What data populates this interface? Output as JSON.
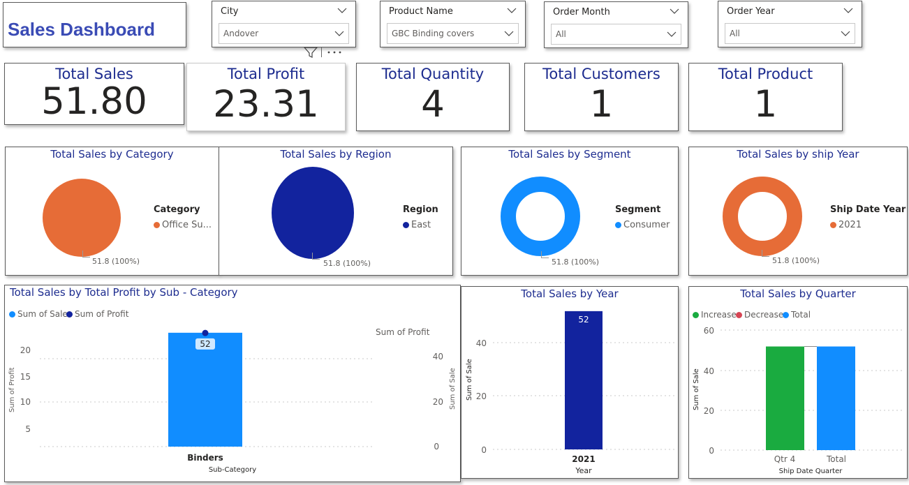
{
  "header": {
    "title": "Sales Dashboard"
  },
  "slicers": [
    {
      "label": "City",
      "value": "Andover"
    },
    {
      "label": "Product Name",
      "value": "GBC Binding covers"
    },
    {
      "label": "Order Month",
      "value": "All"
    },
    {
      "label": "Order Year",
      "value": "All"
    }
  ],
  "visual_header": {
    "filter_icon": "filter-icon",
    "more_icon": "more-options-icon"
  },
  "cards": [
    {
      "title": "Total Sales",
      "value": "51.80"
    },
    {
      "title": "Total Profit",
      "value": "23.31"
    },
    {
      "title": "Total Quantity",
      "value": "4"
    },
    {
      "title": "Total Customers",
      "value": "1"
    },
    {
      "title": "Total Product",
      "value": "1"
    }
  ],
  "pies": [
    {
      "title": "Total Sales by Category",
      "legend_title": "Category",
      "legend_item": "Office Su...",
      "color": "#e66c37",
      "label": "51.8 (100%)",
      "donut": false
    },
    {
      "title": "Total Sales by Region",
      "legend_title": "Region",
      "legend_item": "East",
      "color": "#12239e",
      "label": "51.8 (100%)",
      "donut": false
    },
    {
      "title": "Total Sales by Segment",
      "legend_title": "Segment",
      "legend_item": "Consumer",
      "color": "#118dff",
      "label": "51.8 (100%)",
      "donut": true
    },
    {
      "title": "Total Sales by ship Year",
      "legend_title": "Ship Date Year",
      "legend_item": "2021",
      "color": "#e66c37",
      "label": "51.8 (100%)",
      "donut": true
    }
  ],
  "combo": {
    "title": "Total Sales by Total Profit by Sub - Category",
    "legend": [
      {
        "name": "Sum of Sale",
        "color": "#118dff"
      },
      {
        "name": "Sum of Profit",
        "color": "#12239e"
      }
    ],
    "ylabel_left": "Sum of Profit",
    "ylabel_right": "Sum of Sale",
    "right_axis_title": "Sum of Profit",
    "left_ticks": [
      "20",
      "15",
      "10",
      "5"
    ],
    "right_ticks": [
      "40",
      "20",
      "0"
    ],
    "category": "Binders",
    "bar_label": "52",
    "xlabel": "Sub-Category"
  },
  "year_chart": {
    "title": "Total Sales by Year",
    "ylabel": "Sum of Sale",
    "xlabel": "Year",
    "ticks": [
      "40",
      "20",
      "0"
    ],
    "category": "2021",
    "bar_label": "52"
  },
  "quarter_chart": {
    "title": "Total Sales by Quarter",
    "legend": [
      {
        "name": "Increase",
        "color": "#1aab40"
      },
      {
        "name": "Decrease",
        "color": "#d64554"
      },
      {
        "name": "Total",
        "color": "#118dff"
      }
    ],
    "ylabel": "Sum of Sale",
    "xlabel": "Ship Date Quarter",
    "ticks": [
      "60",
      "40",
      "20",
      "0"
    ],
    "categories": [
      "Qtr 4",
      "Total"
    ]
  },
  "chart_data": [
    {
      "type": "pie",
      "title": "Total Sales by Category",
      "categories": [
        "Office Su..."
      ],
      "values": [
        51.8
      ],
      "legend_title": "Category"
    },
    {
      "type": "pie",
      "title": "Total Sales by Region",
      "categories": [
        "East"
      ],
      "values": [
        51.8
      ],
      "legend_title": "Region"
    },
    {
      "type": "pie",
      "title": "Total Sales by Segment",
      "categories": [
        "Consumer"
      ],
      "values": [
        51.8
      ],
      "legend_title": "Segment"
    },
    {
      "type": "pie",
      "title": "Total Sales by ship Year",
      "categories": [
        "2021"
      ],
      "values": [
        51.8
      ],
      "legend_title": "Ship Date Year"
    },
    {
      "type": "bar",
      "title": "Total Sales by Total Profit by Sub - Category",
      "categories": [
        "Binders"
      ],
      "series": [
        {
          "name": "Sum of Sale",
          "values": [
            51.8
          ]
        },
        {
          "name": "Sum of Profit",
          "values": [
            23.31
          ]
        }
      ],
      "xlabel": "Sub-Category",
      "ylabel": "Sum of Profit",
      "ylim": [
        0,
        25
      ],
      "y2label": "Sum of Sale",
      "y2lim": [
        0,
        55
      ]
    },
    {
      "type": "bar",
      "title": "Total Sales by Year",
      "categories": [
        "2021"
      ],
      "values": [
        51.8
      ],
      "xlabel": "Year",
      "ylabel": "Sum of Sale",
      "ylim": [
        0,
        55
      ]
    },
    {
      "type": "bar",
      "title": "Total Sales by Quarter",
      "categories": [
        "Qtr 4",
        "Total"
      ],
      "series": [
        {
          "name": "Increase",
          "values": [
            51.8,
            null
          ]
        },
        {
          "name": "Total",
          "values": [
            null,
            51.8
          ]
        }
      ],
      "xlabel": "Ship Date Quarter",
      "ylabel": "Sum of Sale",
      "ylim": [
        0,
        62
      ]
    }
  ]
}
